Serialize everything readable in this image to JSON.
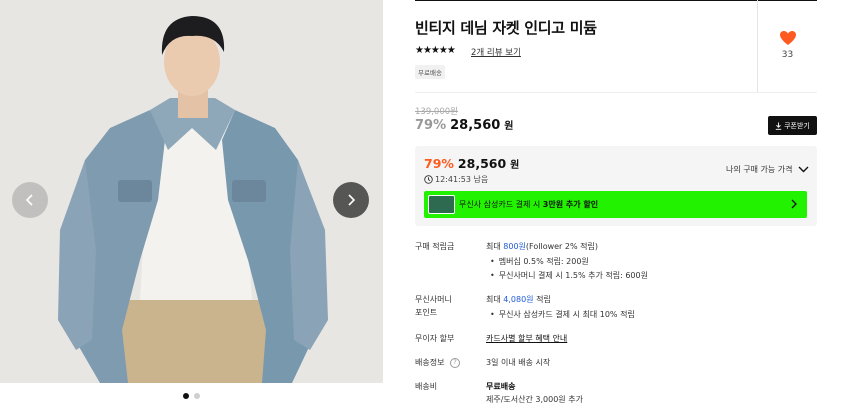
{
  "product": {
    "title": "빈티지 데님 자켓 인디고 미듐",
    "stars": "★★★★★",
    "review_link": "2개 리뷰 보기",
    "badge": "무료배송",
    "like_count": "33"
  },
  "price": {
    "original": "139,000원",
    "discount_rate": "79%",
    "price": "28,560",
    "currency": "원",
    "coupon_label": "쿠폰받기"
  },
  "price_box": {
    "rate": "79%",
    "price": "28,560",
    "currency": "원",
    "timer": "12:41:53 남음",
    "my_price_label": "나의 구매 가능 가격",
    "promo_prefix": "무신사 삼성카드 결제 시",
    "promo_bold": "3만원 추가 할인"
  },
  "details": {
    "points_label": "구매 적립금",
    "points_max_prefix": "최대",
    "points_max_value": "800원",
    "points_max_suffix": "(Follower 2% 적립)",
    "points_bullets": [
      "멤버십 0.5% 적립: 200원",
      "무신사머니 결제 시 1.5% 추가 적립: 600원"
    ],
    "money_label_1": "무신사머니",
    "money_label_2": "포인트",
    "money_max_prefix": "최대",
    "money_max_value": "4,080원",
    "money_max_suffix": "적립",
    "money_bullet": "무신사 삼성카드 결제 시 최대 10% 적립",
    "installment_label": "무이자 할부",
    "installment_link": "카드사별 할부 혜택 안내",
    "shipping_info_label": "배송정보",
    "shipping_info_value": "3일 이내 배송 시작",
    "shipping_fee_label": "배송비",
    "shipping_fee_value": "무료배송",
    "shipping_fee_note": "제주/도서산간 3,000원 추가"
  },
  "icons": {
    "heart": "heart-icon",
    "prev": "chevron-left-icon",
    "next": "chevron-right-icon",
    "clock": "clock-icon",
    "download": "download-icon",
    "chevron_down": "chevron-down-icon",
    "help": "question-icon"
  },
  "colors": {
    "accent_orange": "#ff5a1f",
    "promo_green": "#22f200",
    "link_blue": "#1f5ad8",
    "heart_orange": "#ff5a1f"
  },
  "gallery": {
    "slides": 2,
    "active_slide": 1
  }
}
